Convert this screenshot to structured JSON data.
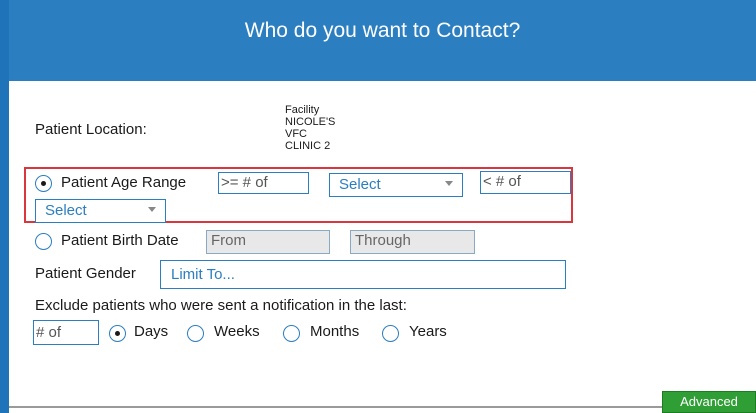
{
  "header": {
    "title": "Who do you want to Contact?"
  },
  "location": {
    "label": "Patient Location:",
    "facility_lines": [
      "Facility",
      "NICOLE'S",
      "VFC",
      "CLINIC 2"
    ]
  },
  "age_range": {
    "label": "Patient Age Range",
    "min_placeholder": ">= # of",
    "min_unit_select": "Select",
    "max_placeholder": "< # of",
    "max_unit_select": "Select",
    "selected": true
  },
  "birth_date": {
    "label": "Patient Birth Date",
    "from_placeholder": "From",
    "through_placeholder": "Through",
    "selected": false
  },
  "gender": {
    "label": "Patient Gender",
    "placeholder": "Limit To..."
  },
  "exclude": {
    "label": "Exclude patients who were sent a notification in the last:",
    "count_placeholder": "# of",
    "options": [
      {
        "label": "Days",
        "selected": true
      },
      {
        "label": "Weeks",
        "selected": false
      },
      {
        "label": "Months",
        "selected": false
      },
      {
        "label": "Years",
        "selected": false
      }
    ]
  },
  "buttons": {
    "advanced": "Advanced"
  }
}
